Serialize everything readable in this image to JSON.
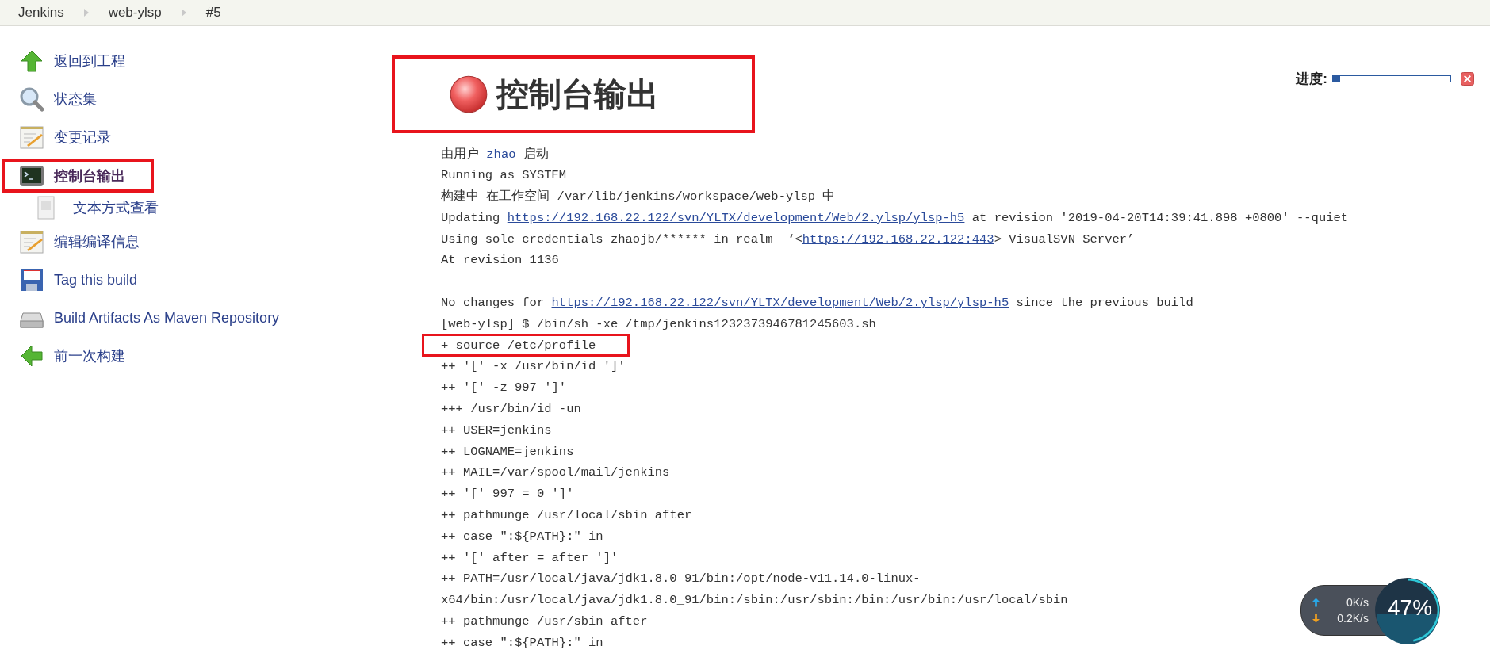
{
  "breadcrumb": [
    "Jenkins",
    "web-ylsp",
    "#5"
  ],
  "sidebar": {
    "items": [
      {
        "label": "返回到工程",
        "kind": "up",
        "selected": false,
        "marked": false
      },
      {
        "label": "状态集",
        "kind": "search",
        "selected": false,
        "marked": false
      },
      {
        "label": "变更记录",
        "kind": "notes",
        "selected": false,
        "marked": false
      },
      {
        "label": "控制台输出",
        "kind": "terminal",
        "selected": true,
        "marked": true,
        "children": [
          {
            "label": "文本方式查看",
            "kind": "document",
            "selected": false,
            "marked": false
          }
        ]
      },
      {
        "label": "编辑编译信息",
        "kind": "notes",
        "selected": false,
        "marked": false
      },
      {
        "label": "Tag this build",
        "kind": "floppy",
        "selected": false,
        "marked": false
      },
      {
        "label": "Build Artifacts As Maven Repository",
        "kind": "drive",
        "selected": false,
        "marked": false
      },
      {
        "label": "前一次构建",
        "kind": "back",
        "selected": false,
        "marked": false
      }
    ]
  },
  "header": {
    "title": "控制台输出",
    "marked": true
  },
  "progress": {
    "label": "进度:",
    "level": 0.06
  },
  "console": {
    "lines": [
      {
        "kind": "text",
        "marked": false,
        "parts": [
          {
            "kind": "text",
            "text": "由用户 "
          },
          {
            "kind": "link",
            "text": "zhao"
          },
          {
            "kind": "text",
            "text": " 启动"
          }
        ]
      },
      {
        "kind": "text",
        "marked": false,
        "parts": [
          {
            "kind": "text",
            "text": "Running as SYSTEM"
          }
        ]
      },
      {
        "kind": "text",
        "marked": false,
        "parts": [
          {
            "kind": "text",
            "text": "构建中 在工作空间 /var/lib/jenkins/workspace/web-ylsp 中"
          }
        ]
      },
      {
        "kind": "text",
        "marked": false,
        "parts": [
          {
            "kind": "text",
            "text": "Updating "
          },
          {
            "kind": "link",
            "text": "https://192.168.22.122/svn/YLTX/development/Web/2.ylsp/ylsp-h5"
          },
          {
            "kind": "text",
            "text": " at revision '2019-04-20T14:39:41.898 +0800' --quiet"
          }
        ]
      },
      {
        "kind": "text",
        "marked": false,
        "parts": [
          {
            "kind": "text",
            "text": "Using sole credentials zhaojb/****** in realm  ‘<"
          },
          {
            "kind": "link",
            "text": "https://192.168.22.122:443"
          },
          {
            "kind": "text",
            "text": "> VisualSVN Server’"
          }
        ]
      },
      {
        "kind": "text",
        "marked": false,
        "parts": [
          {
            "kind": "text",
            "text": "At revision 1136"
          }
        ]
      },
      {
        "kind": "blank",
        "marked": false
      },
      {
        "kind": "text",
        "marked": false,
        "parts": [
          {
            "kind": "text",
            "text": "No changes for "
          },
          {
            "kind": "link",
            "text": "https://192.168.22.122/svn/YLTX/development/Web/2.ylsp/ylsp-h5"
          },
          {
            "kind": "text",
            "text": " since the previous build"
          }
        ]
      },
      {
        "kind": "text",
        "marked": false,
        "parts": [
          {
            "kind": "text",
            "text": "[web-ylsp] $ /bin/sh -xe /tmp/jenkins1232373946781245603.sh"
          }
        ]
      },
      {
        "kind": "text",
        "marked": true,
        "parts": [
          {
            "kind": "text",
            "text": "+ source /etc/profile"
          }
        ]
      },
      {
        "kind": "text",
        "marked": false,
        "parts": [
          {
            "kind": "text",
            "text": "++ '[' -x /usr/bin/id ']'"
          }
        ]
      },
      {
        "kind": "text",
        "marked": false,
        "parts": [
          {
            "kind": "text",
            "text": "++ '[' -z 997 ']'"
          }
        ]
      },
      {
        "kind": "text",
        "marked": false,
        "parts": [
          {
            "kind": "text",
            "text": "+++ /usr/bin/id -un"
          }
        ]
      },
      {
        "kind": "text",
        "marked": false,
        "parts": [
          {
            "kind": "text",
            "text": "++ USER=jenkins"
          }
        ]
      },
      {
        "kind": "text",
        "marked": false,
        "parts": [
          {
            "kind": "text",
            "text": "++ LOGNAME=jenkins"
          }
        ]
      },
      {
        "kind": "text",
        "marked": false,
        "parts": [
          {
            "kind": "text",
            "text": "++ MAIL=/var/spool/mail/jenkins"
          }
        ]
      },
      {
        "kind": "text",
        "marked": false,
        "parts": [
          {
            "kind": "text",
            "text": "++ '[' 997 = 0 ']'"
          }
        ]
      },
      {
        "kind": "text",
        "marked": false,
        "parts": [
          {
            "kind": "text",
            "text": "++ pathmunge /usr/local/sbin after"
          }
        ]
      },
      {
        "kind": "text",
        "marked": false,
        "parts": [
          {
            "kind": "text",
            "text": "++ case \":${PATH}:\" in"
          }
        ]
      },
      {
        "kind": "text",
        "marked": false,
        "parts": [
          {
            "kind": "text",
            "text": "++ '[' after = after ']'"
          }
        ]
      },
      {
        "kind": "text",
        "marked": false,
        "parts": [
          {
            "kind": "text",
            "text": "++ PATH=/usr/local/java/jdk1.8.0_91/bin:/opt/node-v11.14.0-linux-"
          }
        ]
      },
      {
        "kind": "text",
        "marked": false,
        "parts": [
          {
            "kind": "text",
            "text": "x64/bin:/usr/local/java/jdk1.8.0_91/bin:/sbin:/usr/sbin:/bin:/usr/bin:/usr/local/sbin"
          }
        ]
      },
      {
        "kind": "text",
        "marked": false,
        "parts": [
          {
            "kind": "text",
            "text": "++ pathmunge /usr/sbin after"
          }
        ]
      },
      {
        "kind": "text",
        "marked": false,
        "parts": [
          {
            "kind": "text",
            "text": "++ case \":${PATH}:\" in"
          }
        ]
      }
    ]
  },
  "net_widget": {
    "upload": "0K/s",
    "download": "0.2K/s",
    "percent": "47%",
    "level": 0.47
  }
}
